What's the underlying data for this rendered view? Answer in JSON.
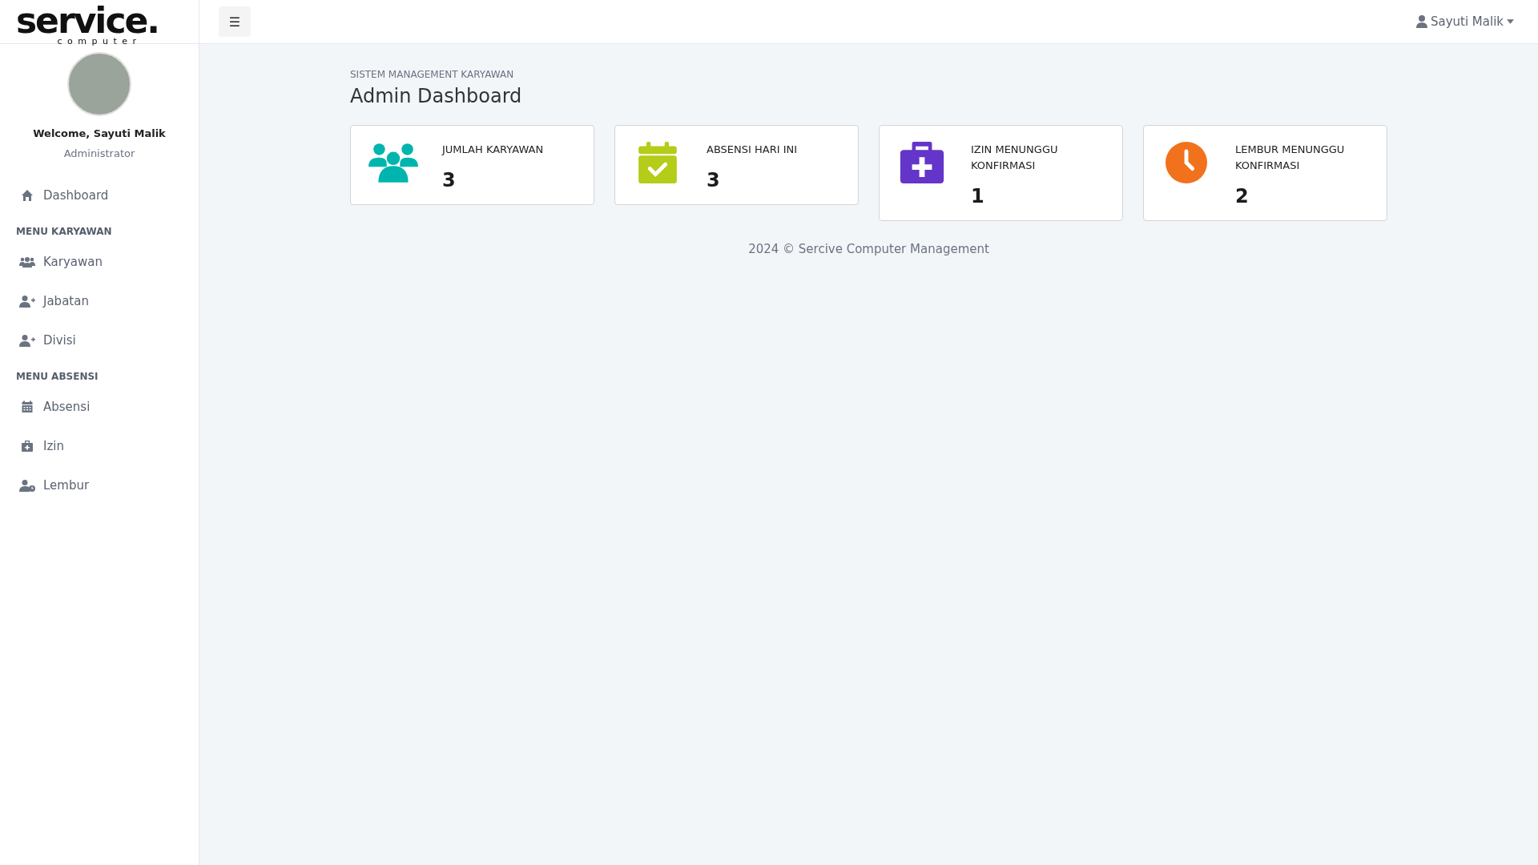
{
  "logo": {
    "word": "service.",
    "sub": "computer"
  },
  "profile": {
    "welcome": "Welcome, Sayuti Malik",
    "role": "Administrator"
  },
  "sidebar": {
    "sections": [
      {
        "items": [
          {
            "label": "Dashboard",
            "kind": "home"
          }
        ]
      },
      {
        "heading": "MENU KARYAWAN",
        "items": [
          {
            "label": "Karyawan",
            "kind": "users"
          },
          {
            "label": "Jabatan",
            "kind": "user-plus"
          },
          {
            "label": "Divisi",
            "kind": "user-plus"
          }
        ]
      },
      {
        "heading": "MENU ABSENSI",
        "items": [
          {
            "label": "Absensi",
            "kind": "calendar"
          },
          {
            "label": "Izin",
            "kind": "medkit"
          },
          {
            "label": "Lembur",
            "kind": "user-clock"
          }
        ]
      }
    ]
  },
  "topbar": {
    "menu_toggle": "☰",
    "user": "Sayuti Malik"
  },
  "page": {
    "breadcrumb": "SISTEM MANAGEMENT KARYAWAN",
    "title": "Admin Dashboard"
  },
  "cards": [
    {
      "label": "JUMLAH KARYAWAN",
      "value": "3",
      "kind": "users",
      "color": "#00b5ad"
    },
    {
      "label": "ABSENSI HARI INI",
      "value": "3",
      "kind": "calendar",
      "color": "#b5cc18"
    },
    {
      "label": "IZIN MENUNGGU KONFIRMASI",
      "value": "1",
      "kind": "medkit",
      "color": "#6435c9"
    },
    {
      "label": "LEMBUR MENUNGGU KONFIRMASI",
      "value": "2",
      "kind": "clock",
      "color": "#f2711c"
    }
  ],
  "footer": "2024 © Sercive Computer Management"
}
